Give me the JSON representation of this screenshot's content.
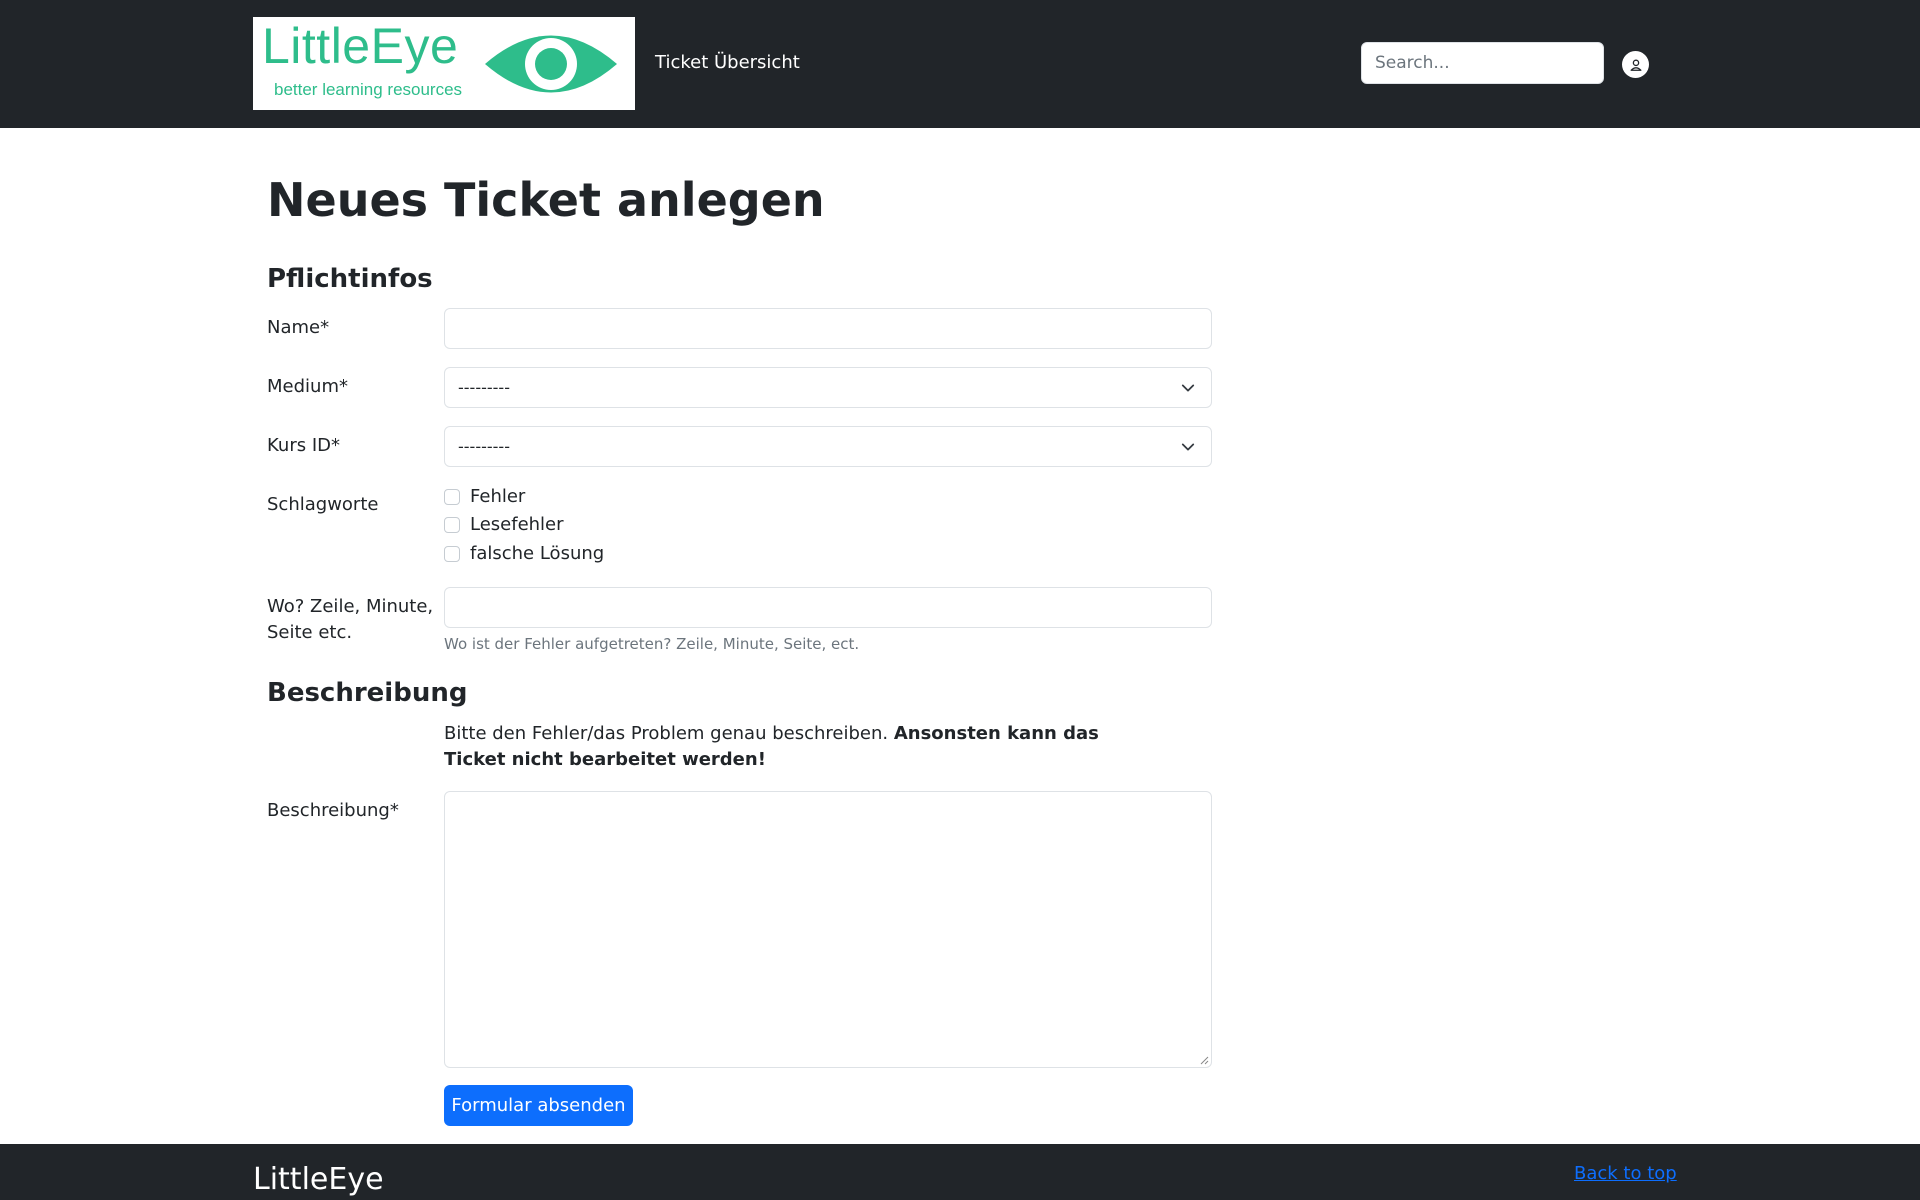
{
  "header": {
    "logo": {
      "title": "LittleEye",
      "subtitle": "better learning resources",
      "color": "#2ebd8b"
    },
    "nav_link": "Ticket Übersicht",
    "search_placeholder": "Search...",
    "user_icon": "user-circle-icon"
  },
  "main": {
    "page_title": "Neues Ticket anlegen",
    "sections": {
      "required": "Pflichtinfos",
      "description": "Beschreibung"
    },
    "fields": {
      "name_label": "Name*",
      "name_value": "",
      "medium_label": "Medium*",
      "medium_value": "---------",
      "course_label": "Kurs ID*",
      "course_value": "---------",
      "tags_label": "Schlagworte",
      "tags": [
        {
          "label": "Fehler",
          "checked": false
        },
        {
          "label": "Lesefehler",
          "checked": false
        },
        {
          "label": "falsche Lösung",
          "checked": false
        }
      ],
      "location_label_line1": "Wo? Zeile, Minute,",
      "location_label_line2": "Seite etc.",
      "location_value": "",
      "location_help": "Wo ist der Fehler aufgetreten? Zeile, Minute, Seite, ect.",
      "description_intro": "Bitte den Fehler/das Problem genau beschreiben. ",
      "description_intro_bold": "Ansonsten kann das Ticket nicht bearbeitet werden!",
      "description_label": "Beschreibung*",
      "description_value": ""
    },
    "submit_label": "Formular absenden"
  },
  "footer": {
    "brand": "LittleEye",
    "back_to_top": "Back to top"
  },
  "colors": {
    "navbar": "#212529",
    "primary": "#0d6efd",
    "brand": "#2ebd8b"
  }
}
